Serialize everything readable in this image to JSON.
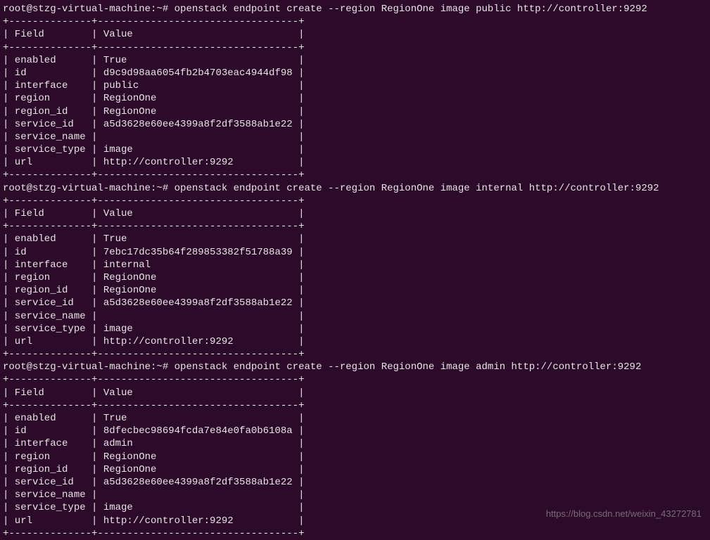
{
  "prompt": "root@stzg-virtual-machine:~# ",
  "commands": [
    {
      "cmd": "openstack endpoint create --region RegionOne image public http://controller:9292",
      "table": {
        "header": [
          "Field",
          "Value"
        ],
        "rows": [
          [
            "enabled",
            "True"
          ],
          [
            "id",
            "d9c9d98aa6054fb2b4703eac4944df98"
          ],
          [
            "interface",
            "public"
          ],
          [
            "region",
            "RegionOne"
          ],
          [
            "region_id",
            "RegionOne"
          ],
          [
            "service_id",
            "a5d3628e60ee4399a8f2df3588ab1e22"
          ],
          [
            "service_name",
            ""
          ],
          [
            "service_type",
            "image"
          ],
          [
            "url",
            "http://controller:9292"
          ]
        ]
      }
    },
    {
      "cmd": "openstack endpoint create --region RegionOne image internal http://controller:9292",
      "table": {
        "header": [
          "Field",
          "Value"
        ],
        "rows": [
          [
            "enabled",
            "True"
          ],
          [
            "id",
            "7ebc17dc35b64f289853382f51788a39"
          ],
          [
            "interface",
            "internal"
          ],
          [
            "region",
            "RegionOne"
          ],
          [
            "region_id",
            "RegionOne"
          ],
          [
            "service_id",
            "a5d3628e60ee4399a8f2df3588ab1e22"
          ],
          [
            "service_name",
            ""
          ],
          [
            "service_type",
            "image"
          ],
          [
            "url",
            "http://controller:9292"
          ]
        ]
      }
    },
    {
      "cmd": "openstack endpoint create --region RegionOne image admin http://controller:9292",
      "table": {
        "header": [
          "Field",
          "Value"
        ],
        "rows": [
          [
            "enabled",
            "True"
          ],
          [
            "id",
            "8dfecbec98694fcda7e84e0fa0b6108a"
          ],
          [
            "interface",
            "admin"
          ],
          [
            "region",
            "RegionOne"
          ],
          [
            "region_id",
            "RegionOne"
          ],
          [
            "service_id",
            "a5d3628e60ee4399a8f2df3588ab1e22"
          ],
          [
            "service_name",
            ""
          ],
          [
            "service_type",
            "image"
          ],
          [
            "url",
            "http://controller:9292"
          ]
        ]
      }
    }
  ],
  "watermark": "https://blog.csdn.net/weixin_43272781",
  "col1_width": 12,
  "col2_width": 32,
  "border": {
    "corner": "+",
    "h": "-",
    "v": "|"
  }
}
